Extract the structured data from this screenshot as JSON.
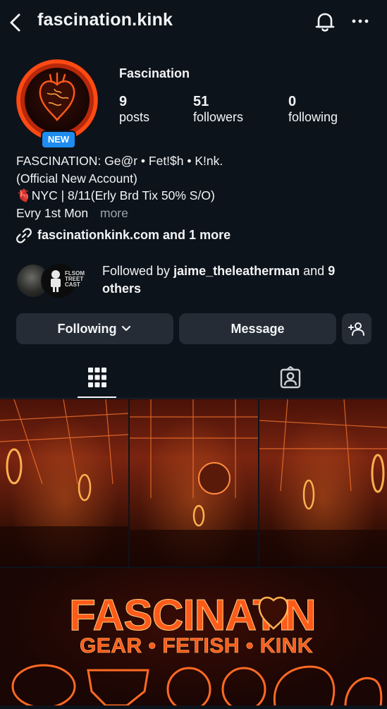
{
  "header": {
    "handle": "fascination.kink"
  },
  "profile": {
    "display_name": "Fascination",
    "badge": "NEW",
    "stats": [
      {
        "value": "9",
        "label": "posts"
      },
      {
        "value": "51",
        "label": "followers"
      },
      {
        "value": "0",
        "label": "following"
      }
    ],
    "bio": {
      "line1": "FASCINATION: Ge@r • Fet!$h • K!nk.",
      "line2": "(Official New Account)",
      "line3_emoji": "🫀",
      "line3": "NYC | 8/11(Erly Brd Tix 50% S/O)",
      "line4": "Evry 1st Mon",
      "more": "more"
    },
    "link": "fascinationkink.com and 1 more",
    "followed_by": {
      "prefix": "Followed by ",
      "user": "jaime_theleatherman",
      "mid": " and ",
      "count": "9",
      "suffix": "others",
      "avatar2_text": "FLSOM\nTREET\nCAST"
    }
  },
  "actions": {
    "following": "Following",
    "message": "Message"
  },
  "tabs": [
    {
      "name": "grid",
      "icon": "grid-icon",
      "active": true
    },
    {
      "name": "tagged",
      "icon": "tagged-icon",
      "active": false
    }
  ],
  "banner": {
    "title_left": "FASCINATI",
    "title_right": "N",
    "subtitle": "GEAR • FETISH • KINK"
  },
  "colors": {
    "background": "#0d131a",
    "button": "#252c36",
    "badge": "#1f8cf0",
    "neon": "#ff4a14"
  }
}
